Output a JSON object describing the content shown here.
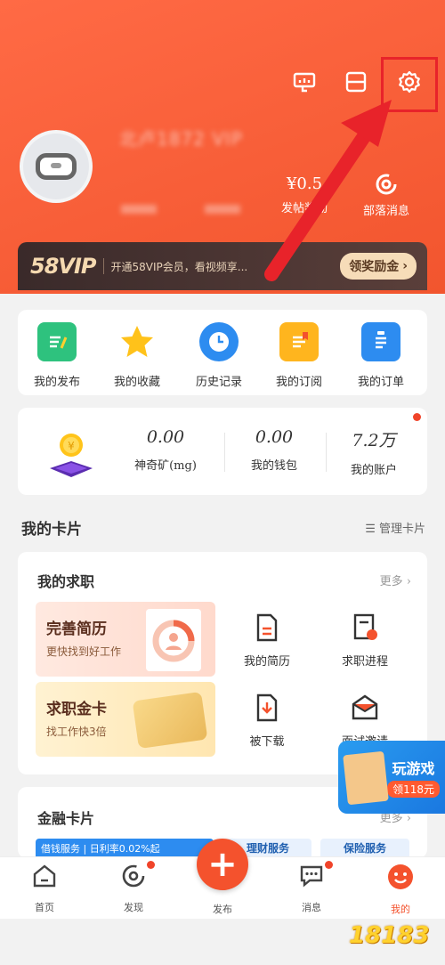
{
  "header": {
    "username": "北卢1872 VIP",
    "stats": [
      {
        "value": "¥0.5",
        "label": "发帖奖励"
      },
      {
        "value": "",
        "label": "部落消息"
      }
    ]
  },
  "vip": {
    "logo": "58VIP",
    "text": "开通58VIP会员，看视频享...",
    "button": "领奖励金"
  },
  "quick": [
    {
      "label": "我的发布"
    },
    {
      "label": "我的收藏"
    },
    {
      "label": "历史记录"
    },
    {
      "label": "我的订阅"
    },
    {
      "label": "我的订单"
    }
  ],
  "wallet": [
    {
      "value": "0.00",
      "label": "神奇矿(mg)"
    },
    {
      "value": "0.00",
      "label": "我的钱包"
    },
    {
      "value": "7.2万",
      "label": "我的账户"
    }
  ],
  "cards_section": {
    "title": "我的卡片",
    "manage": "管理卡片"
  },
  "jobs": {
    "title": "我的求职",
    "more": "更多",
    "promos": [
      {
        "title": "完善简历",
        "sub": "更快找到好工作"
      },
      {
        "title": "求职金卡",
        "sub": "找工作快3倍"
      }
    ],
    "items": [
      {
        "label": "我的简历"
      },
      {
        "label": "求职进程"
      },
      {
        "label": "被下载"
      },
      {
        "label": "面试邀请"
      }
    ]
  },
  "finance": {
    "title": "金融卡片",
    "more": "更多",
    "tags": [
      "借钱服务 | 日利率0.02%起",
      "理财服务",
      "保险服务"
    ]
  },
  "game": {
    "title": "玩游戏",
    "reward": "领118元"
  },
  "nav": [
    {
      "label": "首页"
    },
    {
      "label": "发现"
    },
    {
      "label": "发布"
    },
    {
      "label": "消息"
    },
    {
      "label": "我的"
    }
  ],
  "watermark": "18183"
}
